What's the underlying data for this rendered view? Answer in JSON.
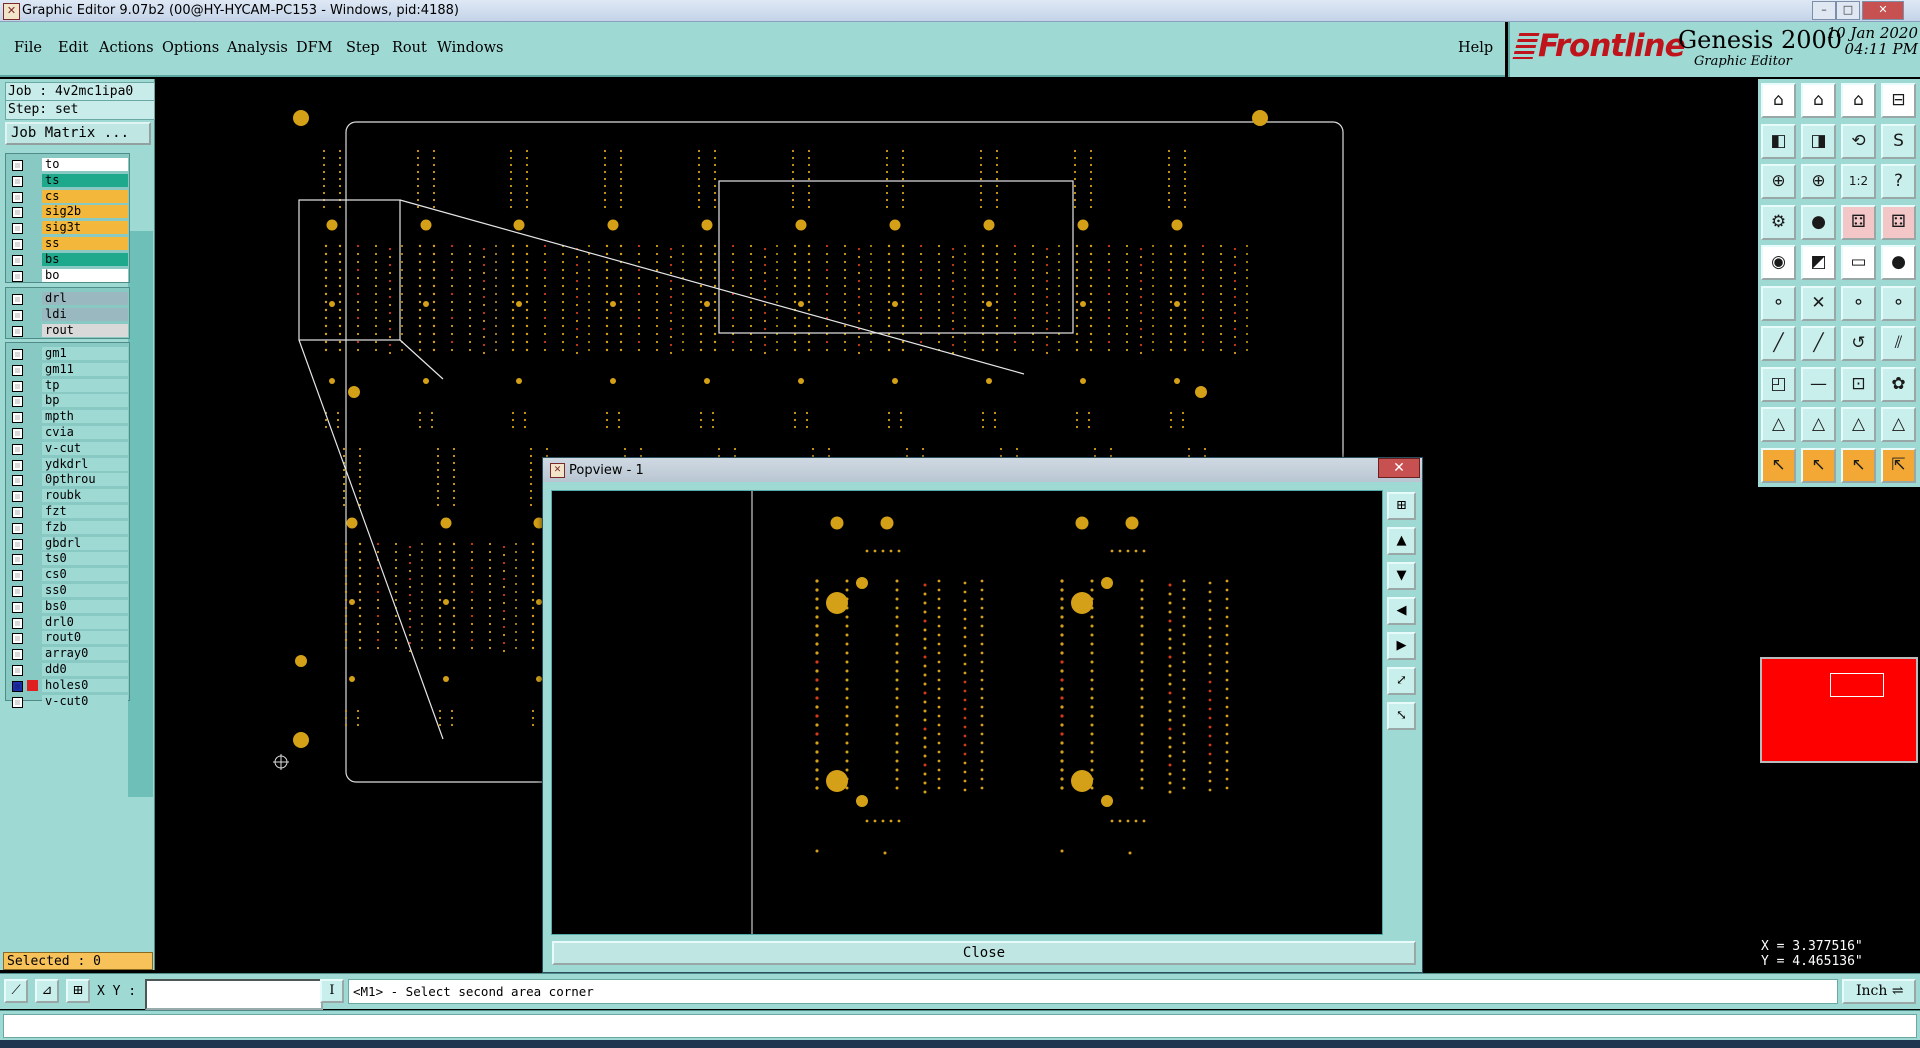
{
  "window": {
    "title": "Graphic Editor 9.07b2 (00@HY-HYCAM-PC153 - Windows, pid:4188)",
    "controls": [
      "–",
      "□",
      "✕"
    ]
  },
  "menubar": {
    "items": [
      "File",
      "Edit",
      "Actions",
      "Options",
      "Analysis",
      "DFM",
      "Step",
      "Rout",
      "Windows"
    ],
    "help": "Help"
  },
  "branding": {
    "logo": "Frontline",
    "product": "Genesis 2000",
    "subtitle": "Graphic Editor",
    "date": "10 Jan 2020",
    "time": "04:11 PM"
  },
  "job": {
    "job_label": "Job : 4v2mc1ipa0",
    "step_label": "Step: set",
    "matrix_button": "Job Matrix ..."
  },
  "layers": {
    "board": [
      {
        "name": "to",
        "color": "#ffffff"
      },
      {
        "name": "ts",
        "color": "#1fa98c"
      },
      {
        "name": "cs",
        "color": "#f3b73c"
      },
      {
        "name": "sig2b",
        "color": "#f3b73c"
      },
      {
        "name": "sig3t",
        "color": "#f3b73c"
      },
      {
        "name": "ss",
        "color": "#f3b73c"
      },
      {
        "name": "bs",
        "color": "#1fa98c"
      },
      {
        "name": "bo",
        "color": "#ffffff"
      }
    ],
    "drill": [
      {
        "name": "drl",
        "color": "#9ab8c0"
      },
      {
        "name": "ldi",
        "color": "#9ab8c0"
      },
      {
        "name": "rout",
        "color": "#d9d9d9"
      }
    ],
    "misc": [
      {
        "name": "gm1",
        "color": "#9fd9d4"
      },
      {
        "name": "gm11",
        "color": "#9fd9d4"
      },
      {
        "name": "tp",
        "color": "#9fd9d4"
      },
      {
        "name": "bp",
        "color": "#9fd9d4"
      },
      {
        "name": "mpth",
        "color": "#9fd9d4"
      },
      {
        "name": "cvia",
        "color": "#9fd9d4"
      },
      {
        "name": "v-cut",
        "color": "#9fd9d4"
      },
      {
        "name": "ydkdrl",
        "color": "#9fd9d4"
      },
      {
        "name": "0pthrou",
        "color": "#9fd9d4"
      },
      {
        "name": "roubk",
        "color": "#9fd9d4"
      },
      {
        "name": "fzt",
        "color": "#9fd9d4"
      },
      {
        "name": "fzb",
        "color": "#9fd9d4"
      },
      {
        "name": "gbdrl",
        "color": "#9fd9d4"
      },
      {
        "name": "ts0",
        "color": "#9fd9d4"
      },
      {
        "name": "cs0",
        "color": "#9fd9d4"
      },
      {
        "name": "ss0",
        "color": "#9fd9d4"
      },
      {
        "name": "bs0",
        "color": "#9fd9d4"
      },
      {
        "name": "drl0",
        "color": "#9fd9d4"
      },
      {
        "name": "rout0",
        "color": "#9fd9d4"
      },
      {
        "name": "array0",
        "color": "#9fd9d4"
      },
      {
        "name": "dd0",
        "color": "#9fd9d4"
      },
      {
        "name": "holes0",
        "color": "#9fd9d4",
        "active": true,
        "swatch": "#e02020"
      },
      {
        "name": "v-cut0",
        "color": "#9fd9d4"
      }
    ],
    "selected_label": "Selected : 0"
  },
  "popview": {
    "title": "Popview - 1",
    "close_label": "Close"
  },
  "commandline": {
    "xy_label": "X Y :",
    "xy_value": "",
    "prompt": "<M1> - Select second area corner",
    "units": "Inch"
  },
  "coordinates": {
    "x": "X = 3.377516\"",
    "y": "Y = 4.465136\""
  },
  "colors": {
    "panel": "#9fd9d4",
    "pad": "#d4a017",
    "drill_red": "#d23a1a",
    "overview": "#ff0000"
  }
}
